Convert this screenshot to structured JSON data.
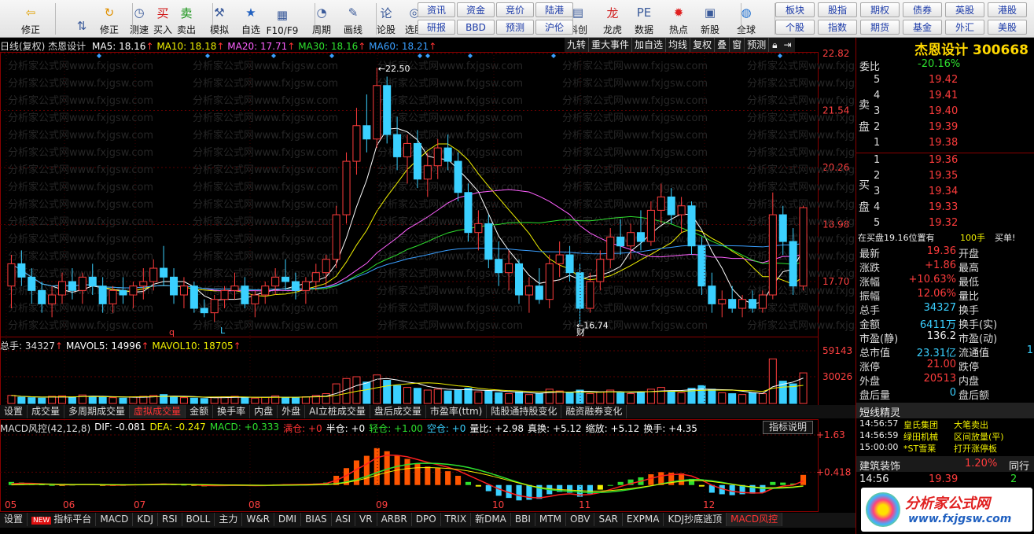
{
  "toolbar": {
    "items": [
      {
        "label": "修正",
        "icon": "back-arrow-icon"
      },
      {
        "label": "",
        "icon": "up-down-arrow-icon"
      },
      {
        "label": "修正",
        "icon": "refresh-icon"
      },
      {
        "label": "测速",
        "icon": "clock-icon"
      },
      {
        "label": "买入",
        "icon": "buy-icon"
      },
      {
        "label": "卖出",
        "icon": "sell-icon"
      },
      {
        "label": "模拟",
        "icon": "hammer-icon"
      },
      {
        "label": "自选",
        "icon": "star-icon"
      },
      {
        "label": "F10/F9",
        "icon": "f10-icon"
      },
      {
        "label": "周期",
        "icon": "period-icon"
      },
      {
        "label": "画线",
        "icon": "pen-icon"
      },
      {
        "label": "论股",
        "icon": "discuss-icon"
      },
      {
        "label": "选股",
        "icon": "select-stock-icon"
      },
      {
        "label": "科创",
        "icon": "tech-icon"
      },
      {
        "label": "龙虎",
        "icon": "dragon-icon"
      },
      {
        "label": "数据",
        "icon": "pe-data-icon"
      },
      {
        "label": "热点",
        "icon": "hot-icon"
      },
      {
        "label": "新股",
        "icon": "ipo-icon"
      },
      {
        "label": "全球",
        "icon": "globe-icon"
      }
    ],
    "quick_buttons": [
      [
        "资讯",
        "资金",
        "竞价",
        "陆港"
      ],
      [
        "研报",
        "BBD",
        "预测",
        "沪伦"
      ]
    ],
    "market_buttons": [
      [
        "板块",
        "股指",
        "期权",
        "债券",
        "英股",
        "港股"
      ],
      [
        "个股",
        "指数",
        "期货",
        "基金",
        "外汇",
        "美股"
      ]
    ]
  },
  "ma_header": {
    "title": "日线(复权) 杰恩设计",
    "ma5": "MA5: 18.16",
    "ma10": "MA10: 18.18",
    "ma20": "MA20: 17.71",
    "ma30": "MA30: 18.16",
    "ma60": "MA60: 18.21"
  },
  "chart_menu": [
    "九转",
    "重大事件",
    "加自选",
    "均线",
    "复权",
    "叠",
    "窗",
    "预测"
  ],
  "price_axis": [
    "22.82",
    "21.54",
    "20.26",
    "18.98",
    "17.70"
  ],
  "annotations": {
    "high": "22.50",
    "low": "16.74",
    "cai": "财",
    "q": "q",
    "L": "L"
  },
  "vol_header": {
    "total": "总手: 34327",
    "mavol5": "MAVOL5: 14996",
    "mavol10": "MAVOL10: 18705"
  },
  "vol_axis": [
    "59143",
    "30026"
  ],
  "vol_tabs": [
    "设置",
    "成交量",
    "多周期成交量",
    "虚拟成交量",
    "金额",
    "换手率",
    "内盘",
    "外盘",
    "AI立桩成交量",
    "盘后成交量",
    "市盈率(ttm)",
    "陆股通持股变化",
    "融资融券变化"
  ],
  "macd_header": {
    "name": "MACD风控(42,12,8)",
    "dif": "DIF: -0.081",
    "dea": "DEA: -0.247",
    "macd": "MACD: +0.333",
    "mancang": "满仓: +0",
    "bancang": "半仓: +0",
    "qingcang": "轻仓: +1.00",
    "kongcang": "空仓: +0",
    "liangbi": "量比: +2.98",
    "zhenhuan": "真换: +5.12",
    "suofang": "缩放: +5.12",
    "huanshou": "换手: +4.35"
  },
  "macd_help": "指标说明",
  "macd_axis": [
    "+1.63",
    "+0.418"
  ],
  "months": [
    "05",
    "06",
    "07",
    "08",
    "09",
    "10",
    "11",
    "12"
  ],
  "bottom_tabs": [
    "设置",
    "指标平台",
    "MACD",
    "KDJ",
    "RSI",
    "BOLL",
    "主力",
    "W&R",
    "DMI",
    "BIAS",
    "ASI",
    "VR",
    "ARBR",
    "DPO",
    "TRIX",
    "新DMA",
    "BBI",
    "MTM",
    "OBV",
    "SAR",
    "EXPMA",
    "KDJ抄底逃顶",
    "MACD风控"
  ],
  "bottom_new_badge": "NEW",
  "watermark": "分析家公式网www.fxjgsw.com",
  "side": {
    "stock_title": "杰恩设计 300668",
    "weibi_label": "委比",
    "weibi": "-20.16%",
    "sell_label": "卖盘",
    "buy_label": "买盘",
    "sell": [
      [
        "5",
        "19.42"
      ],
      [
        "4",
        "19.41"
      ],
      [
        "3",
        "19.40"
      ],
      [
        "2",
        "19.39"
      ],
      [
        "1",
        "19.38"
      ]
    ],
    "buy": [
      [
        "1",
        "19.36"
      ],
      [
        "2",
        "19.35"
      ],
      [
        "3",
        "19.34"
      ],
      [
        "4",
        "19.33"
      ],
      [
        "5",
        "19.32"
      ]
    ],
    "notice": "在买盘19.16位置有",
    "notice_qty": "100手",
    "notice_act": "买单!",
    "stats": [
      [
        "最新",
        "19.36",
        "开盘",
        ""
      ],
      [
        "涨跌",
        "+1.86",
        "最高",
        ""
      ],
      [
        "涨幅",
        "+10.63%",
        "最低",
        ""
      ],
      [
        "振幅",
        "12.06%",
        "量比",
        ""
      ],
      [
        "总手",
        "34327",
        "换手",
        ""
      ],
      [
        "金额",
        "6411万",
        "换手(实)",
        ""
      ],
      [
        "市盈(静)",
        "136.2",
        "市盈(动)",
        ""
      ],
      [
        "总市值",
        "23.31亿",
        "流通值",
        "1"
      ],
      [
        "涨停",
        "21.00",
        "跌停",
        ""
      ],
      [
        "外盘",
        "20513",
        "内盘",
        ""
      ],
      [
        "盘后量",
        "0",
        "盘后额",
        ""
      ]
    ],
    "sprite_title": "短线精灵",
    "sprite": [
      [
        "14:56:57",
        "皇氏集团",
        "大笔卖出"
      ],
      [
        "14:56:59",
        "绿田机械",
        "区间放量(平)"
      ],
      [
        "15:00:00",
        "*ST雪莱",
        "打开涨停板"
      ]
    ],
    "industry": "建筑装饰",
    "industry_pct": "1.20%",
    "tongxing": "同行",
    "tick": {
      "time": "14:56",
      "price": "19.39",
      "vol": "2"
    },
    "logo_text": "分析家公式网",
    "logo_url": "www.fxjgsw.com"
  },
  "colors": {
    "up": "#ff3c3c",
    "down": "#3ad0ff",
    "ma5": "#ffffff",
    "ma10": "#f0f000",
    "ma20": "#ff60ff",
    "ma30": "#2ee02e",
    "ma60": "#3a9fff"
  },
  "chart_data": {
    "type": "candlestick",
    "price_ylim": [
      16.5,
      22.82
    ],
    "candles": [
      [
        17.6,
        18.3,
        17.1,
        18.1
      ],
      [
        18.1,
        18.4,
        17.6,
        17.8
      ],
      [
        17.8,
        18.0,
        17.2,
        17.5
      ],
      [
        17.5,
        17.7,
        17.0,
        17.2
      ],
      [
        17.2,
        17.6,
        16.9,
        17.4
      ],
      [
        17.4,
        17.9,
        17.2,
        17.7
      ],
      [
        17.7,
        18.0,
        17.3,
        17.5
      ],
      [
        17.5,
        17.9,
        17.2,
        17.8
      ],
      [
        17.8,
        18.1,
        17.4,
        17.6
      ],
      [
        17.6,
        17.8,
        17.0,
        17.2
      ],
      [
        17.2,
        17.6,
        17.0,
        17.5
      ],
      [
        17.5,
        17.8,
        17.2,
        17.4
      ],
      [
        17.4,
        17.7,
        17.1,
        17.6
      ],
      [
        17.6,
        18.0,
        17.3,
        17.7
      ],
      [
        17.7,
        18.2,
        17.5,
        18.0
      ],
      [
        18.0,
        18.5,
        17.6,
        17.8
      ],
      [
        17.8,
        18.0,
        17.2,
        17.4
      ],
      [
        17.4,
        17.8,
        17.1,
        17.6
      ],
      [
        17.6,
        17.7,
        17.0,
        17.1
      ],
      [
        17.1,
        17.3,
        16.9,
        17.0
      ],
      [
        17.0,
        17.4,
        16.8,
        17.3
      ],
      [
        17.3,
        17.6,
        17.1,
        17.5
      ],
      [
        17.5,
        17.9,
        17.3,
        17.6
      ],
      [
        17.6,
        17.8,
        17.1,
        17.2
      ],
      [
        17.2,
        17.5,
        16.9,
        17.4
      ],
      [
        17.4,
        17.7,
        17.2,
        17.6
      ],
      [
        17.6,
        18.0,
        17.4,
        17.8
      ],
      [
        17.8,
        18.2,
        17.5,
        17.7
      ],
      [
        17.7,
        17.9,
        17.3,
        17.5
      ],
      [
        17.5,
        17.8,
        17.2,
        17.7
      ],
      [
        17.7,
        18.1,
        17.5,
        17.9
      ],
      [
        17.9,
        18.3,
        17.6,
        18.2
      ],
      [
        18.2,
        19.4,
        18.0,
        19.2
      ],
      [
        19.2,
        20.6,
        19.0,
        20.4
      ],
      [
        20.4,
        21.6,
        20.1,
        21.2
      ],
      [
        21.2,
        21.9,
        20.6,
        20.9
      ],
      [
        20.9,
        22.5,
        20.7,
        22.1
      ],
      [
        22.1,
        22.3,
        20.8,
        21.0
      ],
      [
        21.0,
        21.4,
        20.2,
        20.5
      ],
      [
        20.5,
        21.0,
        19.9,
        20.8
      ],
      [
        20.8,
        21.1,
        19.8,
        20.0
      ],
      [
        20.0,
        20.6,
        19.6,
        20.3
      ],
      [
        20.3,
        20.9,
        20.0,
        20.7
      ],
      [
        20.7,
        21.0,
        20.2,
        20.4
      ],
      [
        20.4,
        20.6,
        19.5,
        19.7
      ],
      [
        19.7,
        19.9,
        18.6,
        18.8
      ],
      [
        18.8,
        19.3,
        18.4,
        19.0
      ],
      [
        19.0,
        19.2,
        18.0,
        18.2
      ],
      [
        18.2,
        18.6,
        17.6,
        17.9
      ],
      [
        17.9,
        18.4,
        17.5,
        18.1
      ],
      [
        18.1,
        18.2,
        17.2,
        17.4
      ],
      [
        17.4,
        17.8,
        17.0,
        17.6
      ],
      [
        17.6,
        18.0,
        17.2,
        17.3
      ],
      [
        17.3,
        18.3,
        17.1,
        18.1
      ],
      [
        18.1,
        18.6,
        17.8,
        18.3
      ],
      [
        18.3,
        18.5,
        17.7,
        17.9
      ],
      [
        17.9,
        18.1,
        16.74,
        17.1
      ],
      [
        17.1,
        17.9,
        17.0,
        17.7
      ],
      [
        17.7,
        18.4,
        17.5,
        18.2
      ],
      [
        18.2,
        18.9,
        18.0,
        18.7
      ],
      [
        18.7,
        19.1,
        18.3,
        18.5
      ],
      [
        18.5,
        19.0,
        18.2,
        18.8
      ],
      [
        18.8,
        19.3,
        18.4,
        18.6
      ],
      [
        18.6,
        19.5,
        18.5,
        19.3
      ],
      [
        19.3,
        19.9,
        19.0,
        19.6
      ],
      [
        19.6,
        19.8,
        19.0,
        19.2
      ],
      [
        19.2,
        19.6,
        18.8,
        19.4
      ],
      [
        19.4,
        19.5,
        18.3,
        18.5
      ],
      [
        18.5,
        18.7,
        17.4,
        17.6
      ],
      [
        17.6,
        17.9,
        17.0,
        17.2
      ],
      [
        17.2,
        17.5,
        16.9,
        17.3
      ],
      [
        17.3,
        17.6,
        17.0,
        17.1
      ],
      [
        17.1,
        17.4,
        16.9,
        17.3
      ],
      [
        17.3,
        17.5,
        17.0,
        17.1
      ],
      [
        17.1,
        17.5,
        17.0,
        17.4
      ],
      [
        17.4,
        19.7,
        17.3,
        19.2
      ],
      [
        19.2,
        19.4,
        18.3,
        18.6
      ],
      [
        18.6,
        18.9,
        17.4,
        17.6
      ],
      [
        17.6,
        19.4,
        17.5,
        19.36
      ]
    ],
    "volume_ylim": [
      0,
      59143
    ],
    "volume": [
      9000,
      7000,
      6500,
      6000,
      8000,
      8500,
      7000,
      9500,
      8000,
      7000,
      6500,
      6000,
      7500,
      8000,
      9000,
      10000,
      7000,
      6500,
      6000,
      5500,
      7000,
      7500,
      8000,
      6500,
      6000,
      7000,
      8500,
      7000,
      6500,
      7500,
      9000,
      11000,
      22000,
      28000,
      30000,
      24000,
      32000,
      26000,
      20000,
      18000,
      17000,
      15000,
      16000,
      14000,
      15000,
      17000,
      13000,
      14000,
      12000,
      11000,
      13000,
      10000,
      11000,
      16000,
      14000,
      12000,
      15000,
      11000,
      13000,
      15000,
      12000,
      11000,
      13000,
      16000,
      18000,
      14000,
      12000,
      17000,
      20000,
      16000,
      12000,
      11000,
      10000,
      12000,
      11000,
      50000,
      25000,
      22000,
      34327
    ],
    "macd_ylim": [
      -0.8,
      1.63
    ],
    "macd": [
      0.1,
      0.08,
      0.05,
      0.02,
      0.0,
      -0.02,
      0.01,
      0.03,
      0.02,
      -0.01,
      -0.02,
      0.0,
      0.02,
      0.03,
      0.04,
      0.05,
      0.02,
      0.01,
      -0.02,
      -0.04,
      -0.03,
      -0.01,
      0.0,
      -0.02,
      -0.03,
      -0.01,
      0.02,
      0.03,
      0.02,
      0.03,
      0.05,
      0.08,
      0.3,
      0.55,
      0.8,
      0.95,
      1.2,
      1.1,
      0.95,
      0.85,
      0.7,
      0.6,
      0.55,
      0.45,
      0.3,
      0.1,
      -0.05,
      -0.2,
      -0.35,
      -0.42,
      -0.5,
      -0.48,
      -0.45,
      -0.3,
      -0.22,
      -0.25,
      -0.38,
      -0.28,
      -0.15,
      0.0,
      0.1,
      0.18,
      0.25,
      0.35,
      0.42,
      0.4,
      0.38,
      0.2,
      -0.05,
      -0.25,
      -0.3,
      -0.33,
      -0.3,
      -0.28,
      -0.25,
      0.1,
      0.08,
      0.05,
      0.33
    ]
  }
}
